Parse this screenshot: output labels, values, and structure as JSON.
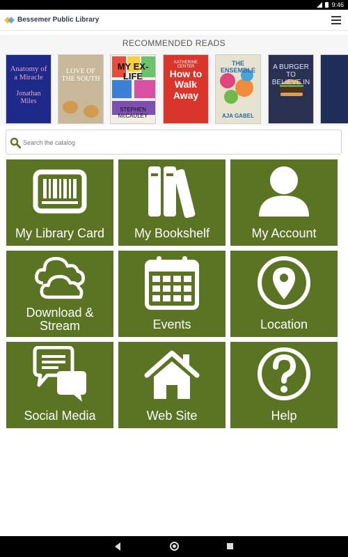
{
  "status": {
    "time": "9:46"
  },
  "header": {
    "brand": "Bessemer Public Library"
  },
  "recommended": {
    "title": "RECOMMENDED READS",
    "books": [
      {
        "title": "Anatomy of a Miracle",
        "author": "Jonathan Miles"
      },
      {
        "title": "LOVE OF THE SOUTH",
        "author": ""
      },
      {
        "title": "MY EX-LIFE",
        "author": "STEPHEN McCAULEY"
      },
      {
        "title": "How to Walk Away",
        "author": "KATHERINE CENTER"
      },
      {
        "title": "THE ENSEMBLE",
        "author": "AJA GABEL"
      },
      {
        "title": "A BURGER TO BELIEVE IN",
        "author": ""
      },
      {
        "title": "",
        "author": ""
      }
    ]
  },
  "search": {
    "placeholder": "Search the catalog",
    "value": ""
  },
  "tiles": [
    {
      "label": "My Library Card",
      "icon": "library-card-icon"
    },
    {
      "label": "My Bookshelf",
      "icon": "bookshelf-icon"
    },
    {
      "label": "My Account",
      "icon": "account-icon"
    },
    {
      "label": "Download & Stream",
      "icon": "cloud-icon"
    },
    {
      "label": "Events",
      "icon": "calendar-icon"
    },
    {
      "label": "Location",
      "icon": "location-pin-icon"
    },
    {
      "label": "Social Media",
      "icon": "chat-bubbles-icon"
    },
    {
      "label": "Web Site",
      "icon": "home-icon"
    },
    {
      "label": "Help",
      "icon": "help-icon"
    }
  ],
  "colors": {
    "tile": "#5b7424",
    "brand": "#2b3a55"
  }
}
